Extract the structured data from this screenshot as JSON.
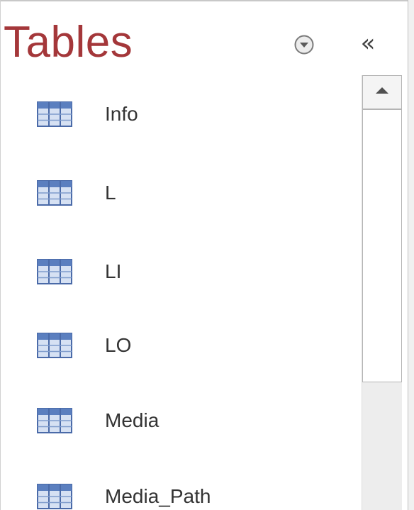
{
  "nav_pane": {
    "title": "Tables",
    "collapse_glyph": "«",
    "icons": {
      "dropdown": "circle-chevron-down-icon",
      "collapse": "double-chevron-left-icon",
      "table": "table-icon",
      "scroll_up": "triangle-up-icon"
    },
    "colors": {
      "title": "#a4373a",
      "table_icon_header": "#5b7fbf",
      "table_icon_cells": "#d6e1f3"
    },
    "items": [
      {
        "label": "Info"
      },
      {
        "label": "L"
      },
      {
        "label": "LI"
      },
      {
        "label": "LO"
      },
      {
        "label": "Media"
      },
      {
        "label": "Media_Path"
      }
    ]
  }
}
